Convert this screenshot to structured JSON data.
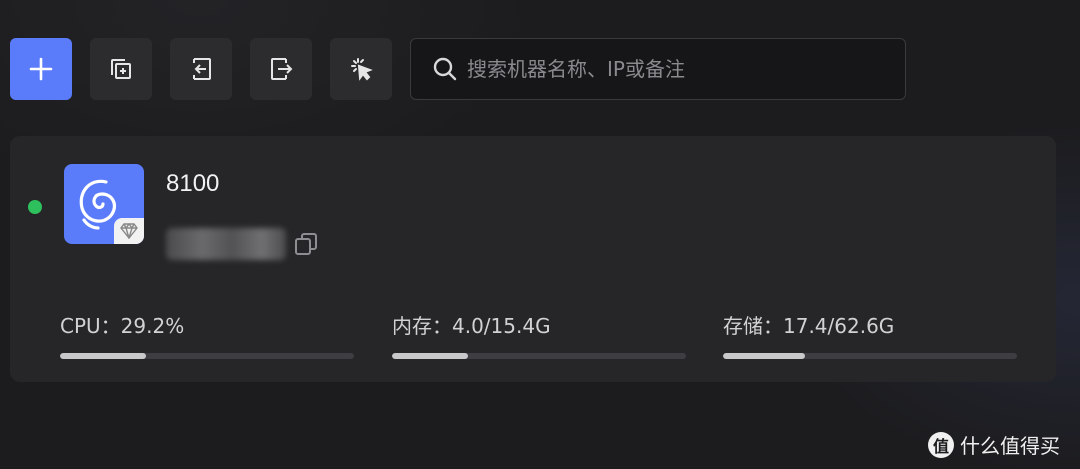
{
  "toolbar": {
    "buttons": [
      {
        "icon": "plus-icon"
      },
      {
        "icon": "copy-add-icon"
      },
      {
        "icon": "import-icon"
      },
      {
        "icon": "export-icon"
      },
      {
        "icon": "select-icon"
      }
    ]
  },
  "search": {
    "placeholder": "搜索机器名称、IP或备注",
    "value": ""
  },
  "machine": {
    "name": "8100",
    "status": "online",
    "status_color": "#2ec05c",
    "os_icon": "debian-icon",
    "os_color": "#5b7cfa",
    "stats": [
      {
        "label": "CPU：29.2%",
        "fraction": 0.292
      },
      {
        "label": "内存：4.0/15.4G",
        "fraction": 0.26
      },
      {
        "label": "存储：17.4/62.6G",
        "fraction": 0.278
      }
    ]
  },
  "watermark": {
    "logo": "值",
    "text": "什么值得买"
  },
  "colors": {
    "accent": "#5b7cfa",
    "background": "#1c1c1e",
    "card": "#262628"
  }
}
